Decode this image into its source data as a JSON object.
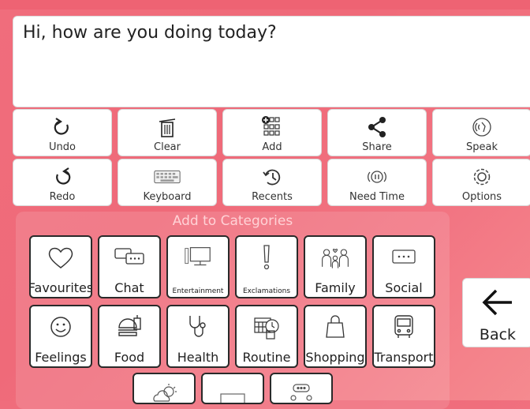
{
  "message": {
    "text": "Hi, how are you doing today?"
  },
  "toolbar": {
    "undo": "Undo",
    "clear": "Clear",
    "add": "Add",
    "share": "Share",
    "speak": "Speak",
    "redo": "Redo",
    "keyboard": "Keyboard",
    "recents": "Recents",
    "need_time": "Need Time",
    "options": "Options"
  },
  "categories": {
    "title": "Add to Categories",
    "favourites": "Favourites",
    "chat": "Chat",
    "entertainment": "Entertainment",
    "exclamations": "Exclamations",
    "family": "Family",
    "social": "Social",
    "feelings": "Feelings",
    "food": "Food",
    "health": "Health",
    "routine": "Routine",
    "shopping": "Shopping",
    "transport": "Transport"
  },
  "back": {
    "label": "Back"
  }
}
